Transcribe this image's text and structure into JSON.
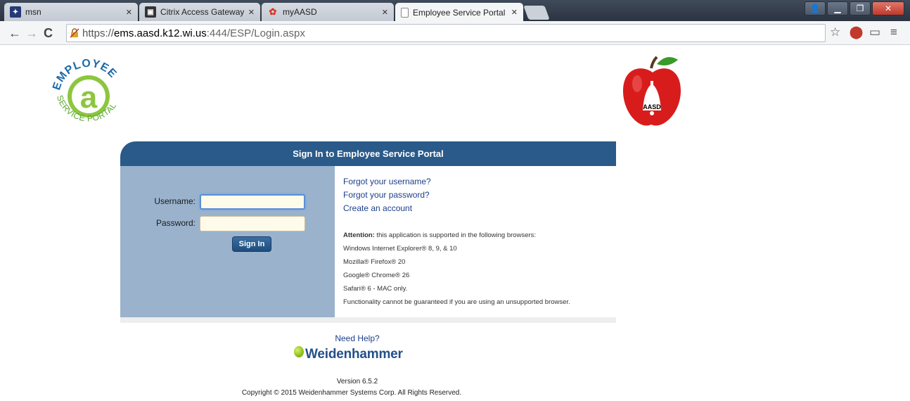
{
  "browser": {
    "tabs": [
      {
        "title": "msn",
        "icon": "msn-icon"
      },
      {
        "title": "Citrix Access Gateway",
        "icon": "citrix-icon"
      },
      {
        "title": "myAASD",
        "icon": "myaasd-icon"
      },
      {
        "title": "Employee Service Portal",
        "icon": "page-icon",
        "active": true
      }
    ],
    "url": {
      "scheme": "https://",
      "host": "ems.aasd.k12.wi.us",
      "rest": ":444/ESP/Login.aspx"
    }
  },
  "logos": {
    "esp_text": "EMPLOYEE",
    "esp_sub": "SERVICE PORTAL",
    "aasd_text": "AASD"
  },
  "login": {
    "header": "Sign In to Employee Service Portal",
    "username_label": "Username:",
    "password_label": "Password:",
    "username_value": "",
    "password_value": "",
    "signin_label": "Sign In"
  },
  "links": {
    "forgot_username": "Forgot your username?",
    "forgot_password": "Forgot your password?",
    "create_account": "Create an account"
  },
  "attention": {
    "heading": "Attention:",
    "intro": " this application is supported in the following browsers:",
    "browsers": [
      "Windows Internet Explorer® 8, 9, & 10",
      "Mozilla® Firefox® 20",
      "Google® Chrome® 26",
      "Safari® 6 - MAC only."
    ],
    "warning": "Functionality cannot be guaranteed if you are using an unsupported browser."
  },
  "footer": {
    "need_help": "Need Help?",
    "brand": "Weidenhammer",
    "version": "Version 6.5.2",
    "copyright": "Copyright © 2015 Weidenhammer Systems Corp. All Rights Reserved."
  }
}
